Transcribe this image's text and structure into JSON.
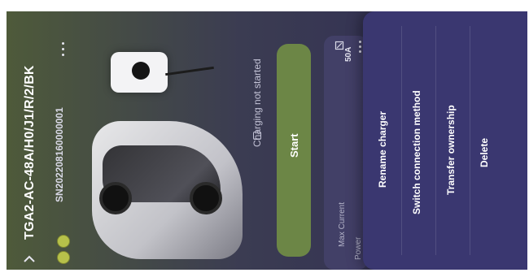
{
  "header": {
    "title": "TGA2-AC-48A/H0/J1/R/2/BK",
    "serial": "SN202208160000001"
  },
  "charging": {
    "status": "Charging not started",
    "start_label": "Start"
  },
  "info_card": {
    "current_value": "50A",
    "max_current_label": "Max Current",
    "power_label": "Power"
  },
  "sheet": {
    "items": [
      {
        "label": "Rename charger"
      },
      {
        "label": "Switch connection method"
      },
      {
        "label": "Transfer ownership"
      },
      {
        "label": "Delete"
      }
    ]
  },
  "icons": {
    "back": "chevron-left-icon",
    "more": "more-dots-icon",
    "edit": "edit-icon"
  },
  "colors": {
    "accent_green": "#6c8646",
    "sheet_bg": "#3a3770",
    "badge": "#b7c14a"
  }
}
